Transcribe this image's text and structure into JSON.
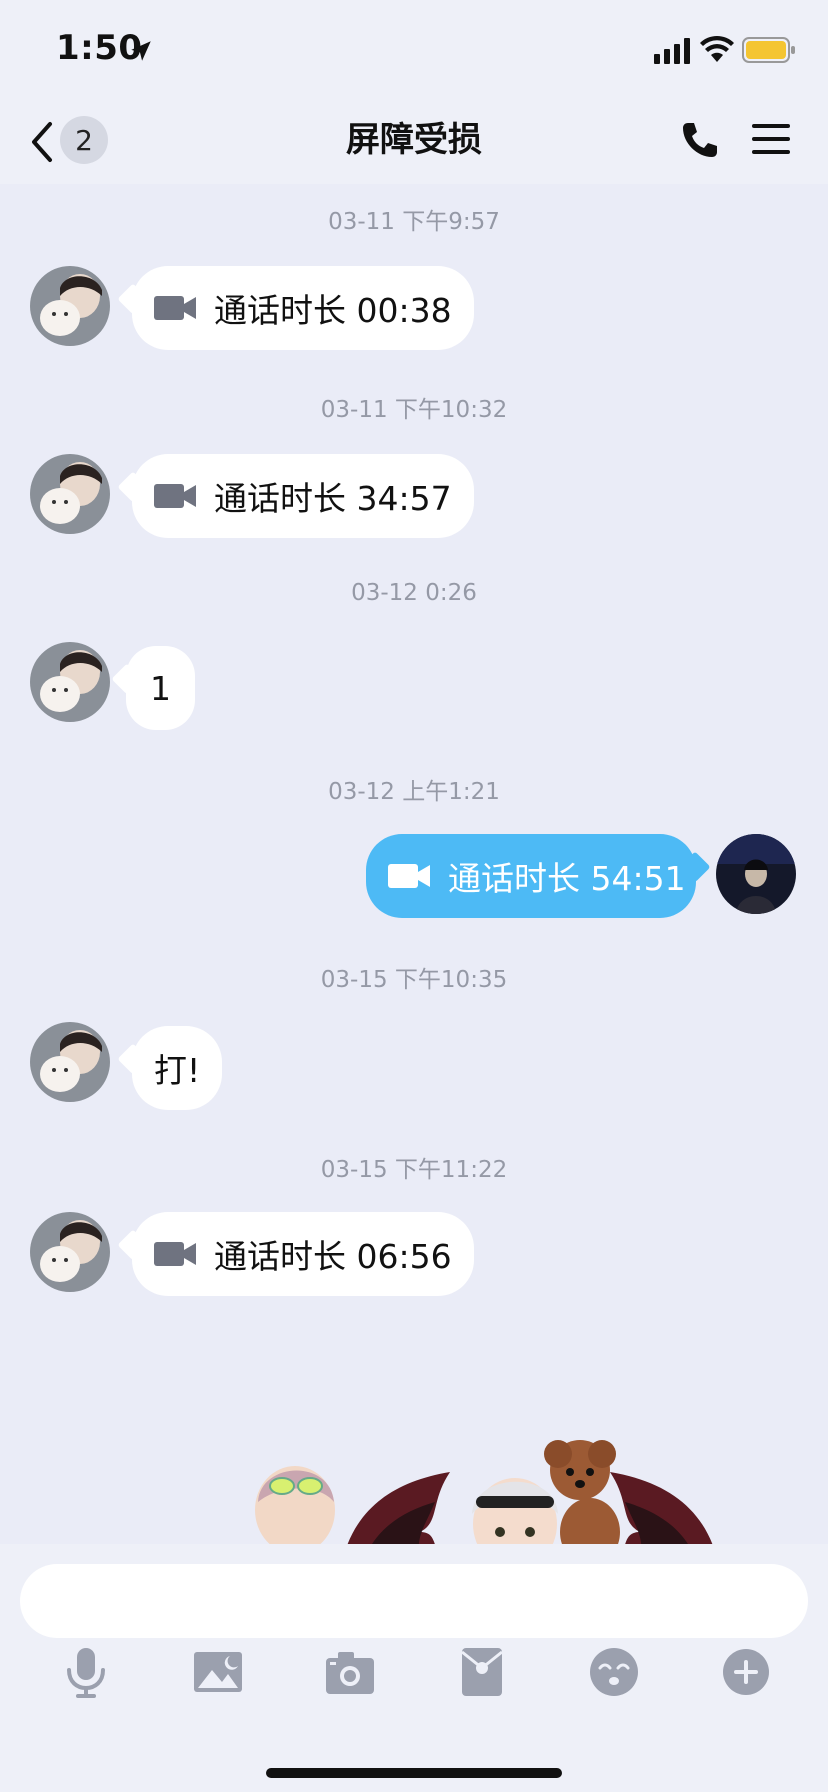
{
  "status_bar": {
    "time": "1:50",
    "icons": [
      "location-arrow-icon",
      "cellular-signal-icon",
      "wifi-icon",
      "battery-icon"
    ],
    "battery_color": "#f4c531"
  },
  "nav": {
    "back_icon": "chevron-left-icon",
    "unread_count": "2",
    "title": "屏障受损",
    "right_icons": [
      "phone-icon",
      "menu-icon"
    ]
  },
  "messages": [
    {
      "timestamp": "03-11 下午9:57",
      "direction": "received",
      "type": "video-call",
      "text": "通话时长 00:38"
    },
    {
      "timestamp": "03-11 下午10:32",
      "direction": "received",
      "type": "video-call",
      "text": "通话时长 34:57"
    },
    {
      "timestamp": "03-12 0:26",
      "direction": "received",
      "type": "text",
      "text": "1"
    },
    {
      "timestamp": "03-12 上午1:21",
      "direction": "sent",
      "type": "video-call",
      "text": "通话时长 54:51"
    },
    {
      "timestamp": "03-15 下午10:35",
      "direction": "received",
      "type": "text",
      "text": "打!"
    },
    {
      "timestamp": "03-15 下午11:22",
      "direction": "received",
      "type": "video-call",
      "text": "通话时长 06:56"
    }
  ],
  "input": {
    "placeholder": "",
    "value": ""
  },
  "toolbar": [
    "microphone-icon",
    "image-icon",
    "camera-icon",
    "red-packet-icon",
    "emoji-icon",
    "plus-icon"
  ],
  "colors": {
    "sent_bubble": "#4dbaf5",
    "received_bubble": "#ffffff",
    "background": "#eaecf7",
    "timestamp_text": "#9599a6",
    "toolbar_icon": "#9ba0ae"
  }
}
